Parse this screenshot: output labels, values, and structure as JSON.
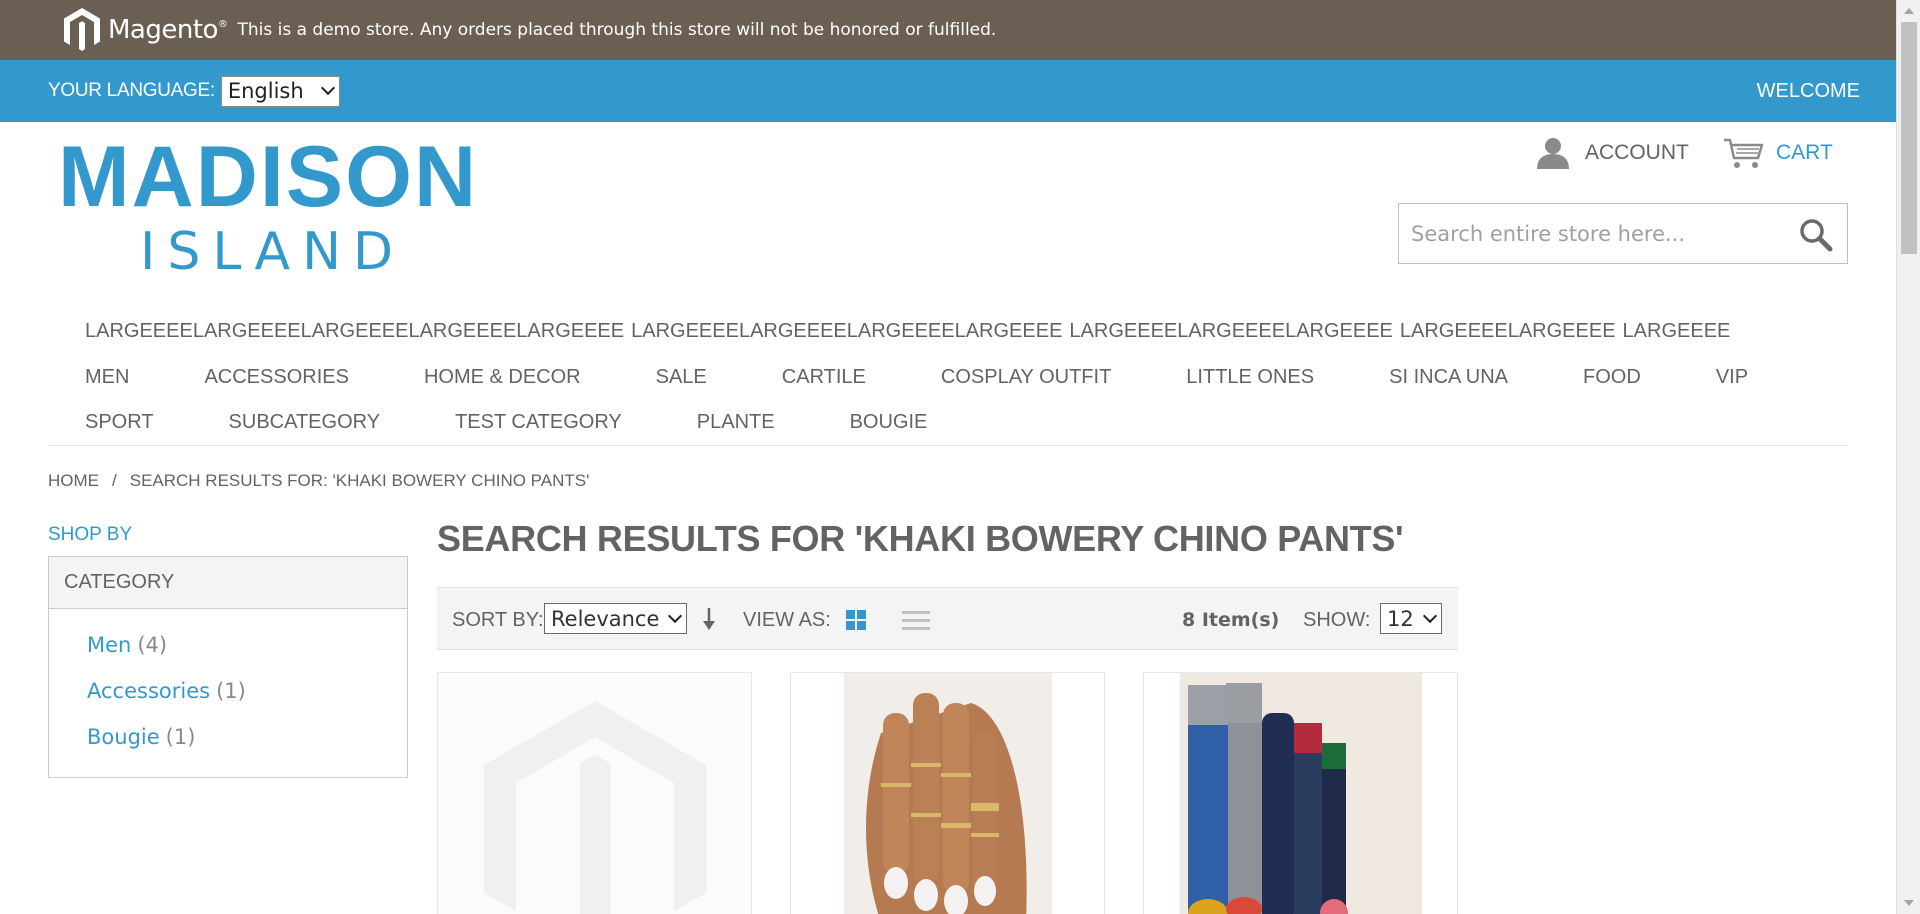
{
  "demo_notice": {
    "brand": "Magento",
    "brand_mark": "®",
    "text": "This is a demo store. Any orders placed through this store will not be honored or fulfilled."
  },
  "language_bar": {
    "label": "YOUR LANGUAGE:",
    "selected": "English",
    "welcome": "WELCOME"
  },
  "header": {
    "logo_line1": "MADISON",
    "logo_line2": "ISLAND",
    "account_label": "ACCOUNT",
    "cart_label": "CART",
    "search_placeholder": "Search entire store here..."
  },
  "nav": {
    "row0": [
      "LARGEEEELARGEEEELARGEEEELARGEEEELARGEEEE",
      "LARGEEEELARGEEEELARGEEEELARGEEEE",
      "LARGEEEELARGEEEELARGEEEE",
      "LARGEEEELARGEEEE",
      "LARGEEEE"
    ],
    "row1": [
      "MEN",
      "ACCESSORIES",
      "HOME & DECOR",
      "SALE",
      "CARTILE",
      "COSPLAY OUTFIT",
      "LITTLE ONES",
      "SI INCA UNA",
      "FOOD",
      "VIP"
    ],
    "row2": [
      "SPORT",
      "SUBCATEGORY",
      "TEST CATEGORY",
      "PLANTE",
      "BOUGIE"
    ]
  },
  "breadcrumb": {
    "home": "HOME",
    "separator": "/",
    "current": "SEARCH RESULTS FOR: 'KHAKI BOWERY CHINO PANTS'"
  },
  "sidebar": {
    "shop_by": "SHOP BY",
    "category_title": "CATEGORY",
    "categories": [
      {
        "name": "Men",
        "count": "(4)"
      },
      {
        "name": "Accessories",
        "count": "(1)"
      },
      {
        "name": "Bougie",
        "count": "(1)"
      }
    ]
  },
  "main": {
    "title": "SEARCH RESULTS FOR 'KHAKI BOWERY CHINO PANTS'",
    "toolbar": {
      "sort_label": "SORT BY:",
      "sort_value": "Relevance",
      "view_label": "VIEW AS:",
      "item_count": "8 Item(s)",
      "show_label": "SHOW:",
      "show_value": "12"
    }
  },
  "colors": {
    "accent": "#3399cc",
    "demo_bar": "#6b5f54",
    "text": "#636363"
  }
}
